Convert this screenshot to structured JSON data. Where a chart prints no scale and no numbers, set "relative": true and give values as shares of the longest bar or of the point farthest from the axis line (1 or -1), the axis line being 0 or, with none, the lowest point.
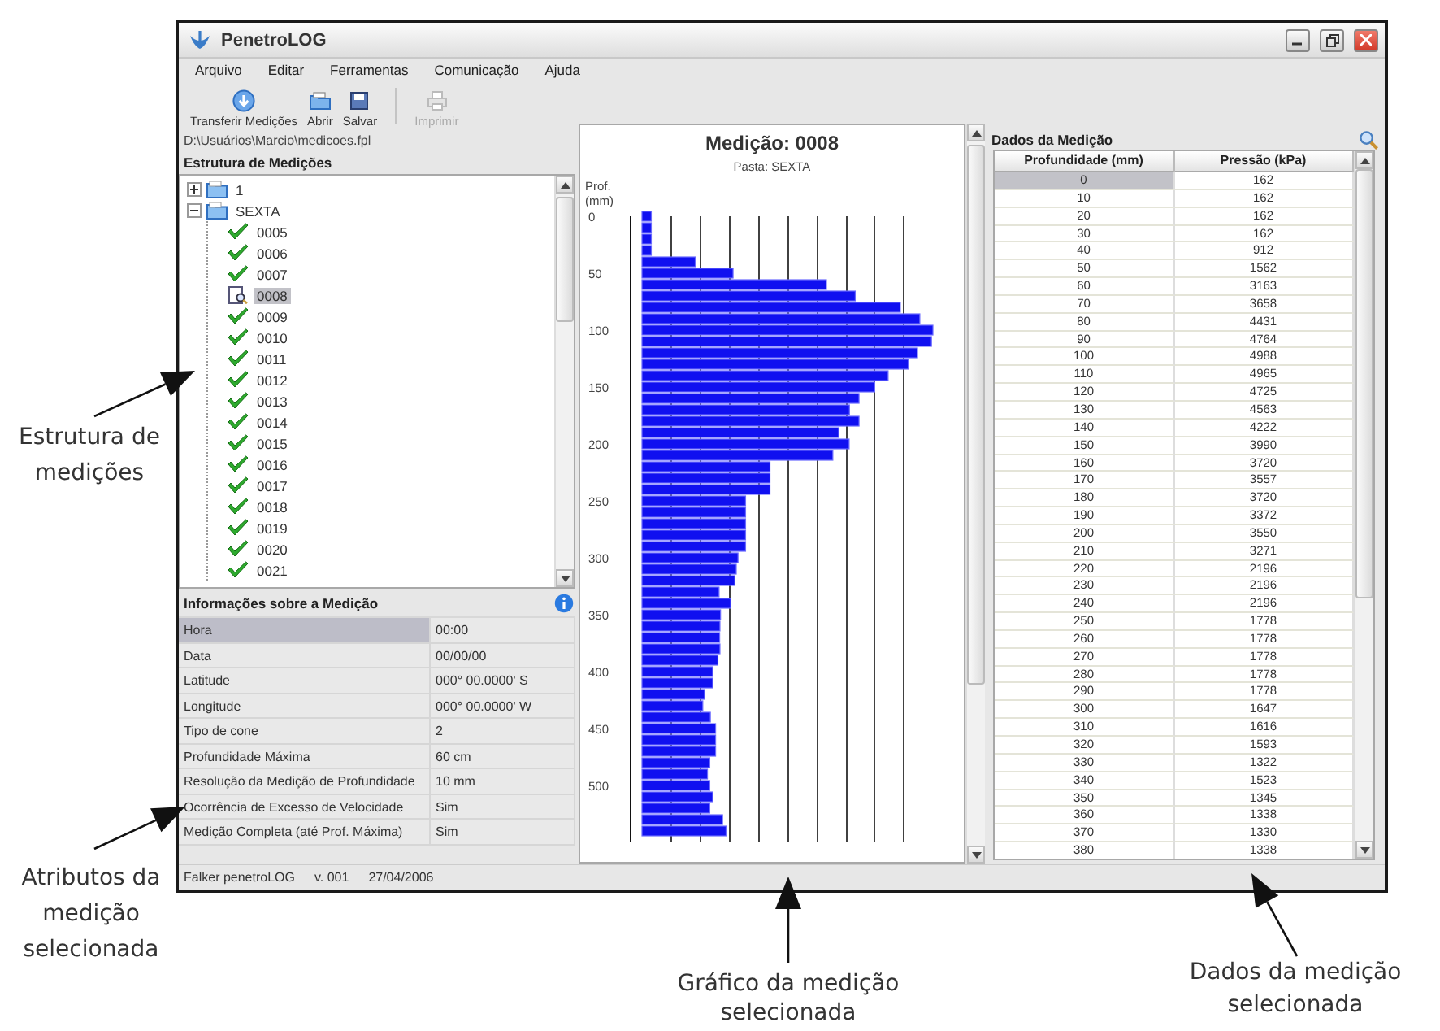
{
  "window": {
    "title": "PenetroLOG"
  },
  "menu": [
    "Arquivo",
    "Editar",
    "Ferramentas",
    "Comunicação",
    "Ajuda"
  ],
  "toolbar": [
    {
      "kind": "transfer",
      "label": "Transferir Medições",
      "disabled": false
    },
    {
      "kind": "open",
      "label": "Abrir",
      "disabled": false
    },
    {
      "kind": "save",
      "label": "Salvar",
      "disabled": false
    },
    {
      "kind": "print",
      "label": "Imprimir",
      "disabled": true
    }
  ],
  "file_path": "D:\\Usuários\\Marcio\\medicoes.fpl",
  "tree": {
    "title": "Estrutura de Medições",
    "items": [
      {
        "label": "1",
        "expanded": false,
        "selected": false
      },
      {
        "label": "SEXTA",
        "expanded": true,
        "selected": false,
        "children": [
          {
            "label": "0005",
            "selected": false
          },
          {
            "label": "0006",
            "selected": false
          },
          {
            "label": "0007",
            "selected": false
          },
          {
            "label": "0008",
            "selected": true
          },
          {
            "label": "0009",
            "selected": false
          },
          {
            "label": "0010",
            "selected": false
          },
          {
            "label": "0011",
            "selected": false
          },
          {
            "label": "0012",
            "selected": false
          },
          {
            "label": "0013",
            "selected": false
          },
          {
            "label": "0014",
            "selected": false
          },
          {
            "label": "0015",
            "selected": false
          },
          {
            "label": "0016",
            "selected": false
          },
          {
            "label": "0017",
            "selected": false
          },
          {
            "label": "0018",
            "selected": false
          },
          {
            "label": "0019",
            "selected": false
          },
          {
            "label": "0020",
            "selected": false
          },
          {
            "label": "0021",
            "selected": false
          }
        ]
      }
    ]
  },
  "info": {
    "title": "Informações sobre a Medição",
    "rows": [
      {
        "label": "Hora",
        "value": "00:00",
        "selected": true
      },
      {
        "label": "Data",
        "value": "00/00/00",
        "selected": false
      },
      {
        "label": "Latitude",
        "value": "000° 00.0000' S",
        "selected": false
      },
      {
        "label": "Longitude",
        "value": "000° 00.0000' W",
        "selected": false
      },
      {
        "label": "Tipo de cone",
        "value": "2",
        "selected": false
      },
      {
        "label": "Profundidade Máxima",
        "value": "60 cm",
        "selected": false
      },
      {
        "label": "Resolução da Medição de Profundidade",
        "value": "10 mm",
        "selected": false
      },
      {
        "label": "Ocorrência de Excesso de Velocidade",
        "value": "Sim",
        "selected": false
      },
      {
        "label": "Medição Completa (até Prof. Máxima)",
        "value": "Sim",
        "selected": false
      }
    ]
  },
  "chart": {
    "title": "Medição: 0008",
    "subtitle": "Pasta: SEXTA",
    "chart_data": {
      "type": "bar",
      "orientation": "horizontal",
      "relative": true,
      "ylabel": "Prof. (mm)",
      "ylim": [
        550,
        0
      ],
      "x": [
        0,
        10,
        20,
        30,
        40,
        50,
        60,
        70,
        80,
        90,
        100,
        110,
        120,
        130,
        140,
        150,
        160,
        170,
        180,
        190,
        200,
        210,
        220,
        230,
        240,
        250,
        260,
        270,
        280,
        290,
        300,
        310,
        320,
        330,
        340,
        350,
        360,
        370,
        380,
        390,
        400,
        410,
        420,
        430,
        440,
        450,
        460,
        470,
        480,
        490,
        500,
        510,
        520,
        530,
        540
      ],
      "values": [
        0.032,
        0.032,
        0.032,
        0.032,
        0.183,
        0.313,
        0.634,
        0.733,
        0.888,
        0.955,
        1,
        0.995,
        0.947,
        0.915,
        0.846,
        0.8,
        0.746,
        0.713,
        0.746,
        0.676,
        0.712,
        0.656,
        0.44,
        0.44,
        0.44,
        0.356,
        0.356,
        0.356,
        0.356,
        0.356,
        0.33,
        0.324,
        0.319,
        0.265,
        0.305,
        0.27,
        0.268,
        0.267,
        0.268,
        0.261,
        0.243,
        0.243,
        0.215,
        0.209,
        0.235,
        0.253,
        0.253,
        0.253,
        0.233,
        0.225,
        0.233,
        0.243,
        0.233,
        0.277,
        0.289
      ],
      "yticks": [
        0,
        50,
        100,
        150,
        200,
        250,
        300,
        350,
        400,
        450,
        500
      ]
    }
  },
  "data_table": {
    "title": "Dados da Medição",
    "columns": [
      "Profundidade (mm)",
      "Pressão (kPa)"
    ],
    "rows": [
      {
        "cells": [
          "0",
          "162"
        ],
        "selected": true
      },
      {
        "cells": [
          "10",
          "162"
        ],
        "selected": false
      },
      {
        "cells": [
          "20",
          "162"
        ],
        "selected": false
      },
      {
        "cells": [
          "30",
          "162"
        ],
        "selected": false
      },
      {
        "cells": [
          "40",
          "912"
        ],
        "selected": false
      },
      {
        "cells": [
          "50",
          "1562"
        ],
        "selected": false
      },
      {
        "cells": [
          "60",
          "3163"
        ],
        "selected": false
      },
      {
        "cells": [
          "70",
          "3658"
        ],
        "selected": false
      },
      {
        "cells": [
          "80",
          "4431"
        ],
        "selected": false
      },
      {
        "cells": [
          "90",
          "4764"
        ],
        "selected": false
      },
      {
        "cells": [
          "100",
          "4988"
        ],
        "selected": false
      },
      {
        "cells": [
          "110",
          "4965"
        ],
        "selected": false
      },
      {
        "cells": [
          "120",
          "4725"
        ],
        "selected": false
      },
      {
        "cells": [
          "130",
          "4563"
        ],
        "selected": false
      },
      {
        "cells": [
          "140",
          "4222"
        ],
        "selected": false
      },
      {
        "cells": [
          "150",
          "3990"
        ],
        "selected": false
      },
      {
        "cells": [
          "160",
          "3720"
        ],
        "selected": false
      },
      {
        "cells": [
          "170",
          "3557"
        ],
        "selected": false
      },
      {
        "cells": [
          "180",
          "3720"
        ],
        "selected": false
      },
      {
        "cells": [
          "190",
          "3372"
        ],
        "selected": false
      },
      {
        "cells": [
          "200",
          "3550"
        ],
        "selected": false
      },
      {
        "cells": [
          "210",
          "3271"
        ],
        "selected": false
      },
      {
        "cells": [
          "220",
          "2196"
        ],
        "selected": false
      },
      {
        "cells": [
          "230",
          "2196"
        ],
        "selected": false
      },
      {
        "cells": [
          "240",
          "2196"
        ],
        "selected": false
      },
      {
        "cells": [
          "250",
          "1778"
        ],
        "selected": false
      },
      {
        "cells": [
          "260",
          "1778"
        ],
        "selected": false
      },
      {
        "cells": [
          "270",
          "1778"
        ],
        "selected": false
      },
      {
        "cells": [
          "280",
          "1778"
        ],
        "selected": false
      },
      {
        "cells": [
          "290",
          "1778"
        ],
        "selected": false
      },
      {
        "cells": [
          "300",
          "1647"
        ],
        "selected": false
      },
      {
        "cells": [
          "310",
          "1616"
        ],
        "selected": false
      },
      {
        "cells": [
          "320",
          "1593"
        ],
        "selected": false
      },
      {
        "cells": [
          "330",
          "1322"
        ],
        "selected": false
      },
      {
        "cells": [
          "340",
          "1523"
        ],
        "selected": false
      },
      {
        "cells": [
          "350",
          "1345"
        ],
        "selected": false
      },
      {
        "cells": [
          "360",
          "1338"
        ],
        "selected": false
      },
      {
        "cells": [
          "370",
          "1330"
        ],
        "selected": false
      },
      {
        "cells": [
          "380",
          "1338"
        ],
        "selected": false
      }
    ]
  },
  "status_bar": [
    "Falker penetroLOG",
    "v. 001",
    "27/04/2006"
  ],
  "annotations": [
    {
      "text": "Estrutura de medições"
    },
    {
      "text": "Atributos da medição selecionada"
    },
    {
      "text": "Gráfico da medição selecionada"
    },
    {
      "text": "Dados da medição selecionada"
    }
  ]
}
